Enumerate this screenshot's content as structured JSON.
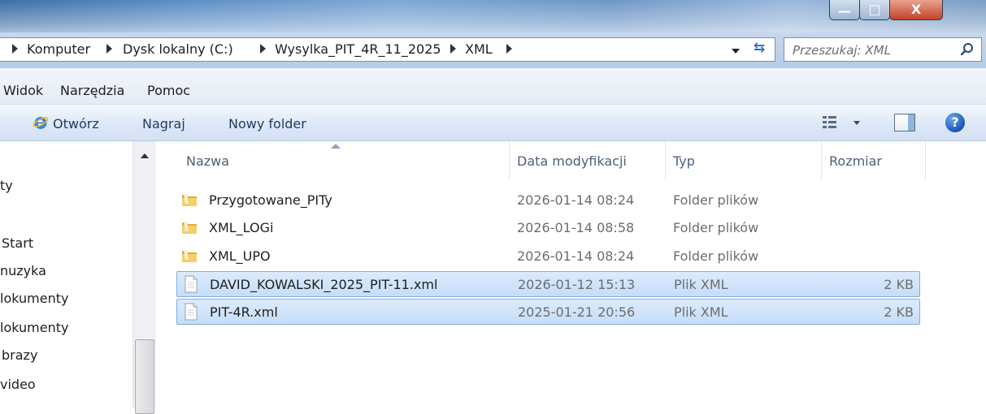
{
  "window": {
    "minimize_glyph": "—",
    "maximize_glyph": "□",
    "close_glyph": "X"
  },
  "address_bar": {
    "breadcrumbs": [
      "Komputer",
      "Dysk lokalny (C:)",
      "Wysylka_PIT_4R_11_2025",
      "XML"
    ],
    "search_placeholder": "Przeszukaj: XML",
    "refresh_glyph": "⇆"
  },
  "menu": {
    "items": [
      "Widok",
      "Narzędzia",
      "Pomoc"
    ]
  },
  "toolbar": {
    "open_label": "Otwórz",
    "burn_label": "Nagraj",
    "new_folder_label": "Nowy folder",
    "help_glyph": "?"
  },
  "nav_pane": {
    "items": [
      "ty",
      "Start",
      "nuzyka",
      "lokumenty",
      "lokumenty",
      "brazy",
      "video"
    ]
  },
  "file_list": {
    "columns": {
      "name": "Nazwa",
      "date": "Data modyfikacji",
      "type": "Typ",
      "size": "Rozmiar"
    },
    "rows": [
      {
        "name": "Przygotowane_PITy",
        "date": "2026-01-14 08:24",
        "type": "Folder plików",
        "size": "",
        "kind": "folder"
      },
      {
        "name": "XML_LOGi",
        "date": "2026-01-14 08:58",
        "type": "Folder plików",
        "size": "",
        "kind": "folder"
      },
      {
        "name": "XML_UPO",
        "date": "2026-01-14 08:24",
        "type": "Folder plików",
        "size": "",
        "kind": "folder"
      },
      {
        "name": "DAVID_KOWALSKI_2025_PIT-11.xml",
        "date": "2026-01-12 15:13",
        "type": "Plik XML",
        "size": "2 KB",
        "kind": "file",
        "selected": true
      },
      {
        "name": "PIT-4R.xml",
        "date": "2025-01-21 20:56",
        "type": "Plik XML",
        "size": "2 KB",
        "kind": "file",
        "selected": true
      }
    ]
  },
  "colors": {
    "selection_fill": "#c4ddf8",
    "selection_border": "#84acdd",
    "folder_yellow": "#f2c04a",
    "header_text": "#4c607a"
  }
}
